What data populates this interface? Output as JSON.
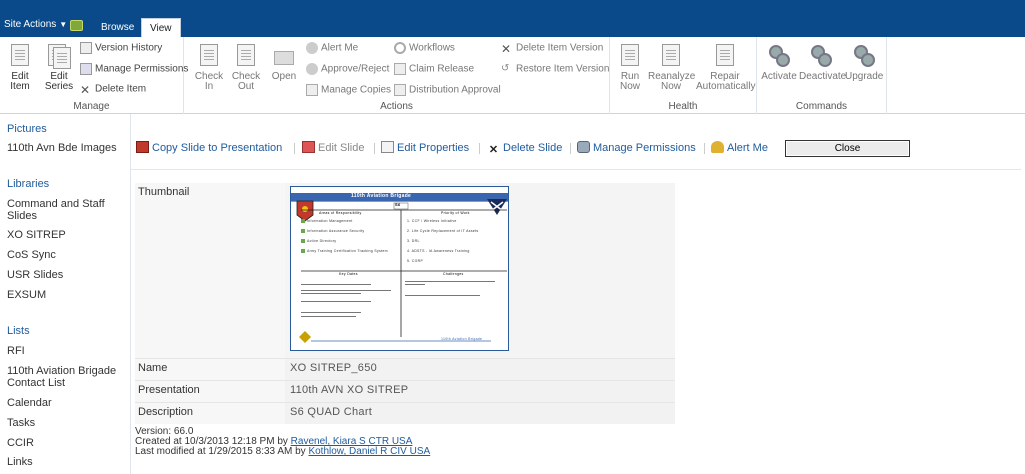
{
  "topbar": {
    "site_actions": "Site Actions",
    "tabs": [
      "Browse",
      "View"
    ]
  },
  "ribbon": {
    "manage": {
      "label": "Manage",
      "edit_item": [
        "Edit",
        "Item"
      ],
      "edit_series": [
        "Edit",
        "Series"
      ],
      "version_history": "Version History",
      "manage_permissions": "Manage Permissions",
      "delete_item": "Delete Item"
    },
    "actions": {
      "label": "Actions",
      "check_in": [
        "Check",
        "In"
      ],
      "check_out": [
        "Check",
        "Out"
      ],
      "open": "Open",
      "alert_me": "Alert Me",
      "approve_reject": "Approve/Reject",
      "manage_copies": "Manage Copies",
      "workflows": "Workflows",
      "claim_release": "Claim Release",
      "distribution_approval": "Distribution Approval",
      "delete_item_version": "Delete Item Version",
      "restore_item_version": "Restore Item Version"
    },
    "health": {
      "label": "Health",
      "run_now": [
        "Run",
        "Now"
      ],
      "reanalyze_now": [
        "Reanalyze",
        "Now"
      ],
      "repair_automatically": [
        "Repair",
        "Automatically"
      ]
    },
    "commands": {
      "label": "Commands",
      "activate": "Activate",
      "deactivate": "Deactivate",
      "upgrade": "Upgrade"
    }
  },
  "leftnav": {
    "pictures_head": "Pictures",
    "pictures": [
      "110th Avn Bde Images"
    ],
    "libraries_head": "Libraries",
    "libraries": [
      "Command and Staff Slides",
      "XO SITREP",
      "CoS Sync",
      "USR Slides",
      "EXSUM"
    ],
    "lists_head": "Lists",
    "lists": [
      "RFI",
      "110th Aviation Brigade Contact List",
      "Calendar",
      "Tasks",
      "CCIR",
      "Links"
    ]
  },
  "toolbar": {
    "copy_slide": "Copy Slide to Presentation",
    "edit_slide": "Edit Slide",
    "edit_properties": "Edit Properties",
    "delete_slide": "Delete Slide",
    "manage_permissions": "Manage Permissions",
    "alert_me": "Alert Me",
    "close": "Close"
  },
  "properties": {
    "thumbnail_label": "Thumbnail",
    "name_label": "Name",
    "name_value": "XO SITREP_650",
    "presentation_label": "Presentation",
    "presentation_value": "110th AVN XO SITREP",
    "description_label": "Description",
    "description_value": "S6 QUAD Chart"
  },
  "slide": {
    "title": "110th Aviation Brigade",
    "section": "S6",
    "q1_title": "Areas of Responsibility",
    "q1_items": [
      "Information Management",
      "Information Assurance Security",
      "Active Directory",
      "Army Training Certification Tracking System"
    ],
    "q2_title": "Priority of Work",
    "q2_items": [
      "1. CCF / Wireless Initiative",
      "2. Life Cycle Replacement of IT Assets",
      "3. DRL",
      "4. ADSTS - IA Awareness Training",
      "5. CGRP"
    ],
    "q3_title": "Key Dates",
    "q4_title": "Challenges",
    "footer": "110th Aviation Brigade"
  },
  "meta": {
    "version": "Version: 66.0",
    "created_prefix": "Created at 10/3/2013 12:18 PM  by",
    "created_by": "Ravenel, Kiara S CTR USA",
    "modified_prefix": "Last modified at 1/29/2015 8:33 AM  by",
    "modified_by": "Kothlow, Daniel R CIV USA"
  }
}
